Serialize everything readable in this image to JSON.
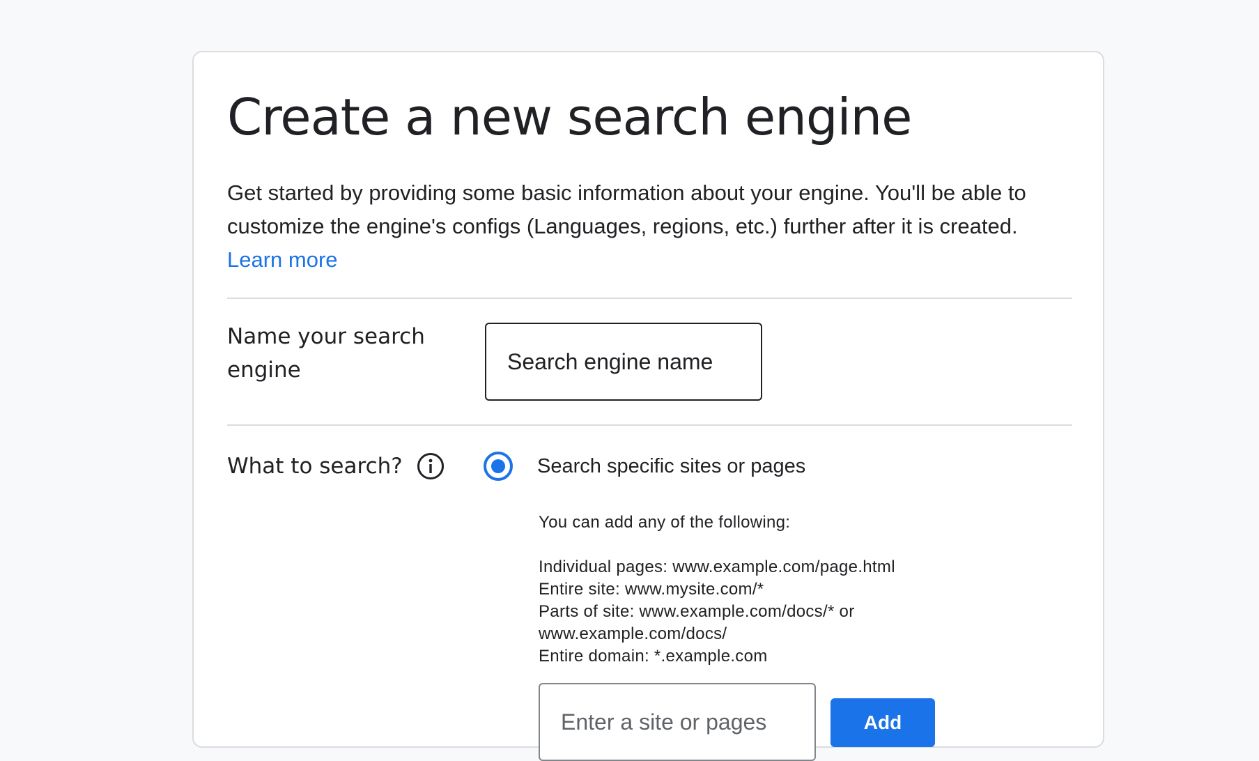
{
  "page": {
    "title": "Create a new search engine",
    "intro": "Get started by providing some basic information about your engine. You'll be able to customize the engine's configs (Languages, regions, etc.) further after it is created.",
    "learn_more": "Learn more"
  },
  "name_section": {
    "label_line1": "Name your search",
    "label_line2": "engine",
    "placeholder": "Search engine name",
    "value": ""
  },
  "what_section": {
    "label": "What to search?",
    "info_icon": "info-icon",
    "option_label": "Search specific sites or pages",
    "option_selected": true,
    "help_heading": "You can add any of the following:",
    "help_lines": [
      "Individual pages: www.example.com/page.html",
      "Entire site: www.mysite.com/*",
      "Parts of site: www.example.com/docs/* or",
      "www.example.com/docs/",
      "Entire domain: *.example.com"
    ],
    "site_placeholder": "Enter a site or pages",
    "add_label": "Add"
  },
  "colors": {
    "accent": "#1a73e8",
    "text": "#202124",
    "divider": "#dadce0",
    "background": "#f8f9fa"
  }
}
